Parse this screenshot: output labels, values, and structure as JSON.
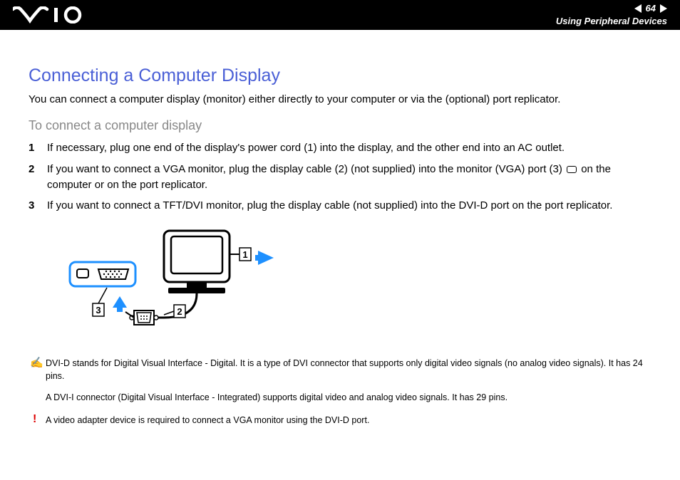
{
  "header": {
    "page_number": "64",
    "section": "Using Peripheral Devices"
  },
  "content": {
    "heading": "Connecting a Computer Display",
    "intro": "You can connect a computer display (monitor) either directly to your computer or via the (optional) port replicator.",
    "sub_heading": "To connect a computer display",
    "steps": [
      "If necessary, plug one end of the display's power cord (1) into the display, and the other end into an AC outlet.",
      "If you want to connect a VGA monitor, plug the display cable (2) (not supplied) into the monitor (VGA) port (3)",
      " on the computer or on the port replicator.",
      "If you want to connect a TFT/DVI monitor, plug the display cable (not supplied) into the DVI-D port on the port replicator."
    ],
    "diagram": {
      "labels": {
        "one": "1",
        "two": "2",
        "three": "3"
      }
    },
    "note": {
      "p1": "DVI-D stands for Digital Visual Interface - Digital. It is a type of DVI connector that supports only digital video signals (no analog video signals). It has 24 pins.",
      "p2": "A DVI-I connector (Digital Visual Interface - Integrated) supports digital video and analog video signals. It has 29 pins."
    },
    "warning": "A video adapter device is required to connect a VGA monitor using the DVI-D port."
  }
}
